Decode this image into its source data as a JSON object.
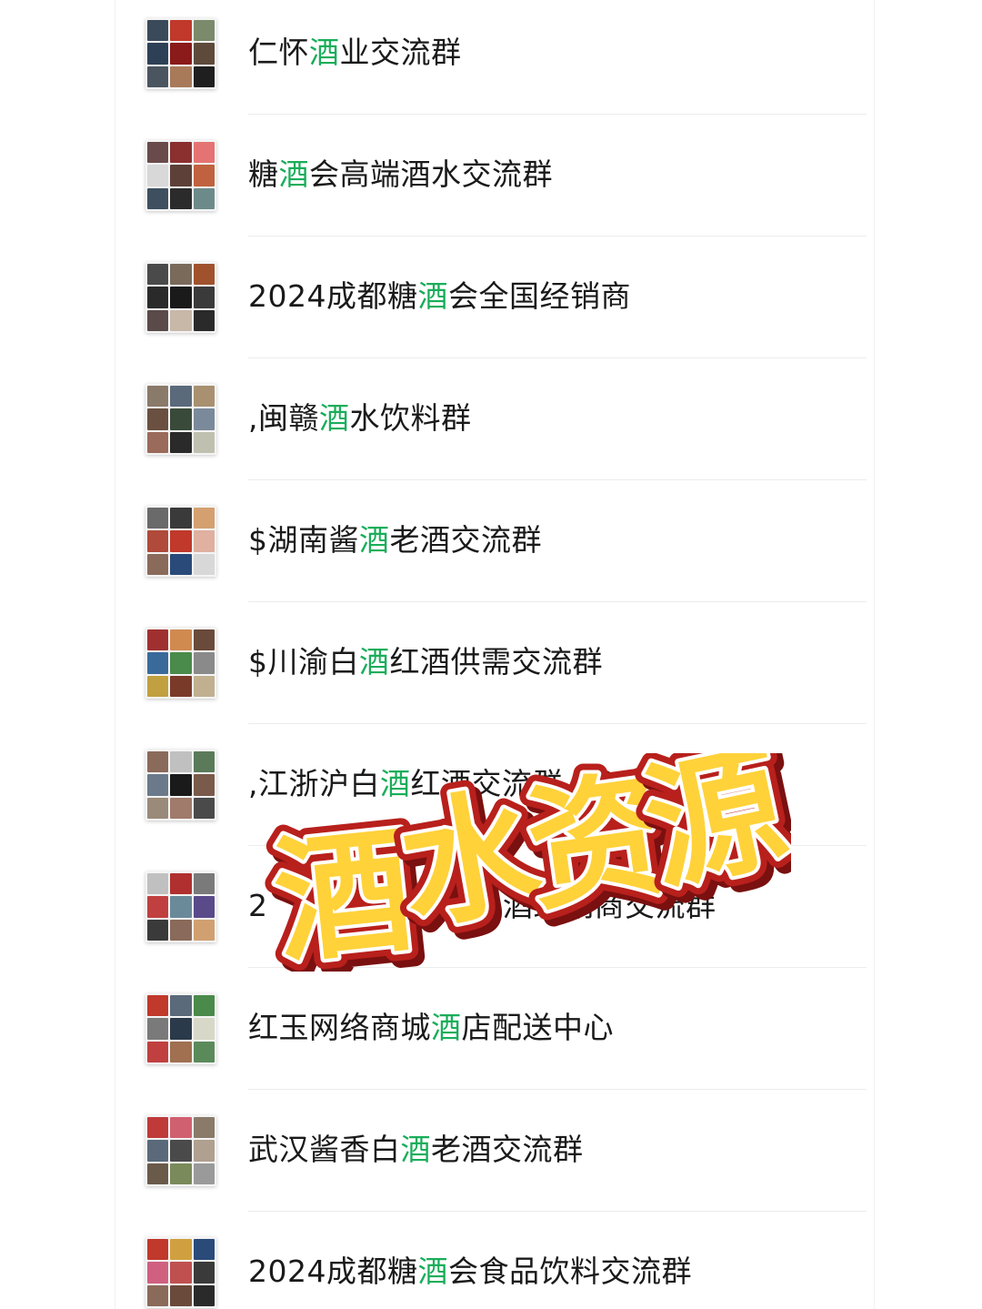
{
  "accent_color": "#1aad5a",
  "groups": [
    {
      "pre": "仁怀",
      "hl": "酒",
      "post": "业交流群",
      "avatar": [
        "#3b4a5a",
        "#c0392b",
        "#7a8a6a",
        "#2e4055",
        "#8b1a1a",
        "#5d4a3a",
        "#4a5560",
        "#a87a5a",
        "#1f1f1f"
      ]
    },
    {
      "pre": "糖",
      "hl": "酒",
      "post": "会高端酒水交流群",
      "avatar": [
        "#6a4a4a",
        "#8b2f2f",
        "#e57373",
        "#d8d8d8",
        "#5d4037",
        "#c0623f",
        "#3e5060",
        "#2b2b2b",
        "#6d8a8a"
      ]
    },
    {
      "pre": "2024成都糖",
      "hl": "酒",
      "post": "会全国经销商",
      "avatar": [
        "#4a4a4a",
        "#7a6a5a",
        "#a0522d",
        "#2a2a2a",
        "#1a1a1a",
        "#3a3a3a",
        "#5a4a4a",
        "#c8b8a8",
        "#2a2a2a"
      ]
    },
    {
      "pre": ",闽赣",
      "hl": "酒",
      "post": "水饮料群",
      "avatar": [
        "#8a7a6a",
        "#5a6a7a",
        "#a89070",
        "#6a5040",
        "#3a4a3a",
        "#7a8a9a",
        "#9a6a5a",
        "#2a2a2a",
        "#c0c0b0"
      ]
    },
    {
      "pre": "$湖南酱",
      "hl": "酒",
      "post": "老酒交流群",
      "avatar": [
        "#6a6a6a",
        "#3a3a3a",
        "#d4a070",
        "#b04a3a",
        "#c0392b",
        "#e0b0a0",
        "#8a6a5a",
        "#2a4a7a",
        "#d8d8d8"
      ]
    },
    {
      "pre": "$川渝白",
      "hl": "酒",
      "post": "红酒供需交流群",
      "avatar": [
        "#a03030",
        "#d08a50",
        "#6a4a3a",
        "#3a6a9a",
        "#4a8a4a",
        "#8a8a8a",
        "#c0a040",
        "#7a3a2a",
        "#c0b090"
      ]
    },
    {
      "pre": ",江浙沪白",
      "hl": "酒",
      "post": "红酒交流群",
      "avatar": [
        "#8a6a5a",
        "#c0c0c0",
        "#5a7a5a",
        "#6a7a8a",
        "#1a1a1a",
        "#7a5a4a",
        "#9a8a7a",
        "#a07a6a",
        "#4a4a4a"
      ]
    },
    {
      "pre": "2",
      "hl": "",
      "post": "",
      "tail": "酒经销商交流群",
      "avatar": [
        "#c0c0c0",
        "#b03030",
        "#7a7a7a",
        "#c04040",
        "#6a8a9a",
        "#5a4a8a",
        "#3a3a3a",
        "#8a6a5a",
        "#d0a070"
      ]
    },
    {
      "pre": "红玉网络商城",
      "hl": "酒",
      "post": "店配送中心",
      "avatar": [
        "#c0392b",
        "#5a6a7a",
        "#4a8a4a",
        "#7a7a7a",
        "#2a3a4a",
        "#d8d8c8",
        "#c04040",
        "#a07050",
        "#5a8a5a"
      ]
    },
    {
      "pre": "武汉酱香白",
      "hl": "酒",
      "post": "老酒交流群",
      "avatar": [
        "#c03a3a",
        "#d06070",
        "#8a7a6a",
        "#5a6a7a",
        "#4a4a4a",
        "#b0a090",
        "#6a5a4a",
        "#7a8a5a",
        "#9a9a9a"
      ]
    },
    {
      "pre": "2024成都糖",
      "hl": "酒",
      "post": "会食品饮料交流群",
      "avatar": [
        "#c0392b",
        "#d0a040",
        "#2a4a7a",
        "#d06080",
        "#c05050",
        "#3a3a3a",
        "#8a6a5a",
        "#6a4a3a",
        "#2a2a2a"
      ]
    }
  ],
  "overlay_text": "酒水资源",
  "overlay_colors": {
    "fill": "#ffd23a",
    "outline": "#b8201c",
    "shadow": "#7a1010",
    "highlight": "#ffffff"
  }
}
